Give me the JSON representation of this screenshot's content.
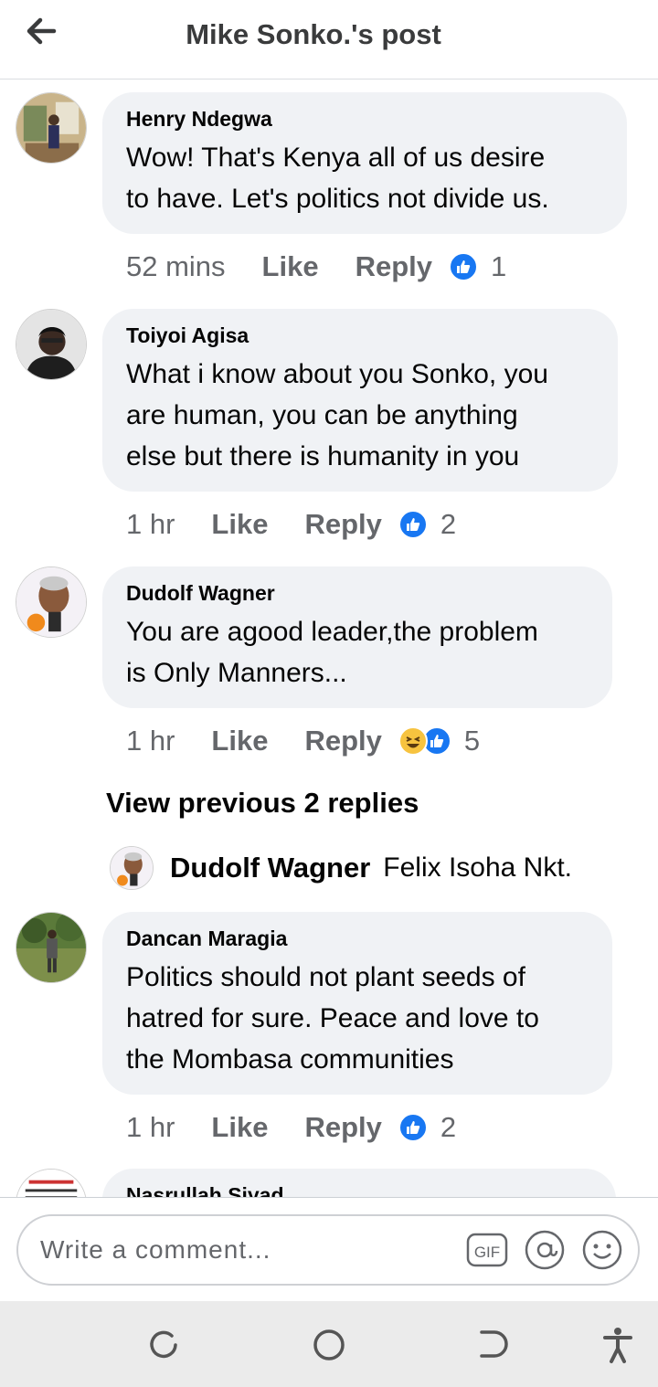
{
  "header": {
    "title": "Mike Sonko.'s post",
    "back_icon": "arrow-left-icon"
  },
  "actions": {
    "like": "Like",
    "reply": "Reply"
  },
  "comments": [
    {
      "author": "Henry Ndegwa",
      "text": "Wow! That's Kenya all of us desire\nto have. Let's politics not divide us.",
      "time": "52 mins",
      "reactions": [
        "like"
      ],
      "count": "1"
    },
    {
      "author": "Toiyoi Agisa",
      "text": "What i know about you Sonko, you\nare human, you can be anything\nelse but there is humanity in you",
      "time": "1 hr",
      "reactions": [
        "like"
      ],
      "count": "2"
    },
    {
      "author": "Dudolf Wagner",
      "text": "You are agood leader,the problem\nis Only Manners...",
      "time": "1 hr",
      "reactions": [
        "haha",
        "like"
      ],
      "count": "5"
    },
    {
      "author": "Dancan Maragia",
      "text": "Politics should not plant seeds of\nhatred for sure. Peace and love to\nthe Mombasa communities",
      "time": "1 hr",
      "reactions": [
        "like"
      ],
      "count": "2"
    },
    {
      "author": "Nasrullah Siyad"
    }
  ],
  "view_previous": "View previous 2 replies",
  "reply_preview": {
    "author": "Dudolf Wagner",
    "text": "Felix Isoha Nkt."
  },
  "composer": {
    "placeholder": "Write a comment...",
    "gif": "GIF",
    "at_icon": "at-sign-icon",
    "emoji_icon": "smiley-icon"
  },
  "navbar": {
    "icons": [
      "recent-apps-icon",
      "home-icon",
      "back-icon",
      "accessibility-icon"
    ]
  },
  "colors": {
    "like_blue": "#1877f2",
    "bubble_bg": "#f0f2f5",
    "meta_gray": "#65676b"
  }
}
